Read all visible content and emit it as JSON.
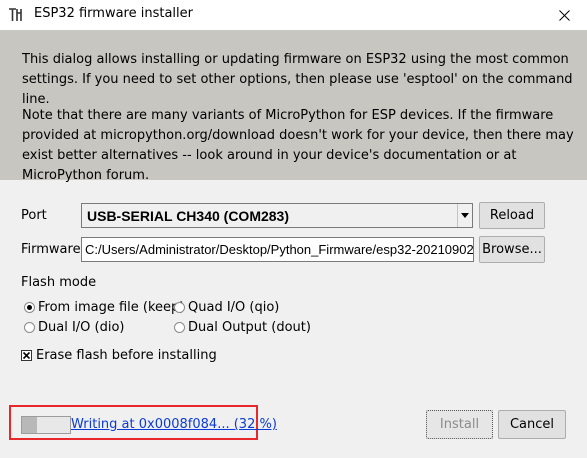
{
  "window": {
    "title": "ESP32 firmware installer"
  },
  "info": {
    "paragraph1": "This dialog allows installing or updating firmware on ESP32 using the most common settings. If you need to set other options, then please use 'esptool' on the command line.",
    "paragraph2": "Note that there are many variants of MicroPython for ESP devices. If the firmware provided at micropython.org/download doesn't work for your device, then there may exist better alternatives -- look around in your device's documentation or at MicroPython forum."
  },
  "port": {
    "label": "Port",
    "value": "USB-SERIAL CH340 (COM283)",
    "reload_label": "Reload"
  },
  "firmware": {
    "label": "Firmware",
    "value": "C:/Users/Administrator/Desktop/Python_Firmware/esp32-20210902",
    "browse_label": "Browse..."
  },
  "flash_mode": {
    "label": "Flash mode",
    "options": [
      {
        "label": "From image file (keep)",
        "selected": true
      },
      {
        "label": "Quad I/O (qio)",
        "selected": false
      },
      {
        "label": "Dual I/O (dio)",
        "selected": false
      },
      {
        "label": "Dual Output (dout)",
        "selected": false
      }
    ]
  },
  "erase": {
    "label": "Erase flash before installing",
    "checked": true
  },
  "progress": {
    "text": "Writing at 0x0008f084... (32 %)",
    "fraction": 0.32
  },
  "buttons": {
    "install_label": "Install",
    "cancel_label": "Cancel"
  },
  "colors": {
    "info_panel_bg": "#c8c6c1",
    "highlight_border": "#e8262b",
    "link": "#0b3bd6"
  }
}
